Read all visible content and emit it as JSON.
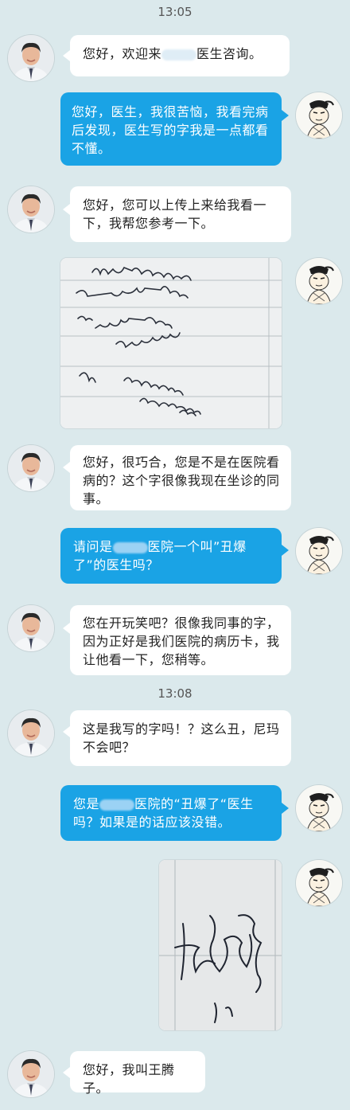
{
  "timestamps": {
    "first": "13:05",
    "second": "13:08"
  },
  "messages": {
    "m1": {
      "prefix": "您好，欢迎来",
      "suffix": "医生咨询。"
    },
    "m2": {
      "text": "您好，医生，我很苦恼，我看完病后发现，医生写的字我是一点都看不懂。"
    },
    "m3": {
      "text": "您好，您可以上传上来给我看一下，我帮您参考一下。"
    },
    "m5": {
      "text": "您好，很巧合，您是不是在医院看病的？这个字很像我现在坐诊的同事。"
    },
    "m6": {
      "prefix": "请问是",
      "suffix": "医院一个叫”丑爆了”的医生吗？"
    },
    "m7": {
      "text": "您在开玩笑吧？很像我同事的字，因为正好是我们医院的病历卡，我让他看一下，您稍等。"
    },
    "m8": {
      "text": "这是我写的字吗！？这么丑，尼玛不会吧？"
    },
    "m9": {
      "prefix": "您是",
      "suffix": "医院的“丑爆了“医生吗？如果是的话应该没错。"
    },
    "m11": {
      "text": "您好，我叫王腾子。"
    }
  },
  "avatars": {
    "doctor": "doctor-avatar",
    "user": "cartoon-avatar"
  },
  "icons": [
    "doctor-avatar",
    "cartoon-avatar",
    "handwriting-photo",
    "signature-photo"
  ],
  "colors": {
    "background": "#dbe9ec",
    "outgoing": "#1aa3e5",
    "incoming": "#ffffff"
  }
}
